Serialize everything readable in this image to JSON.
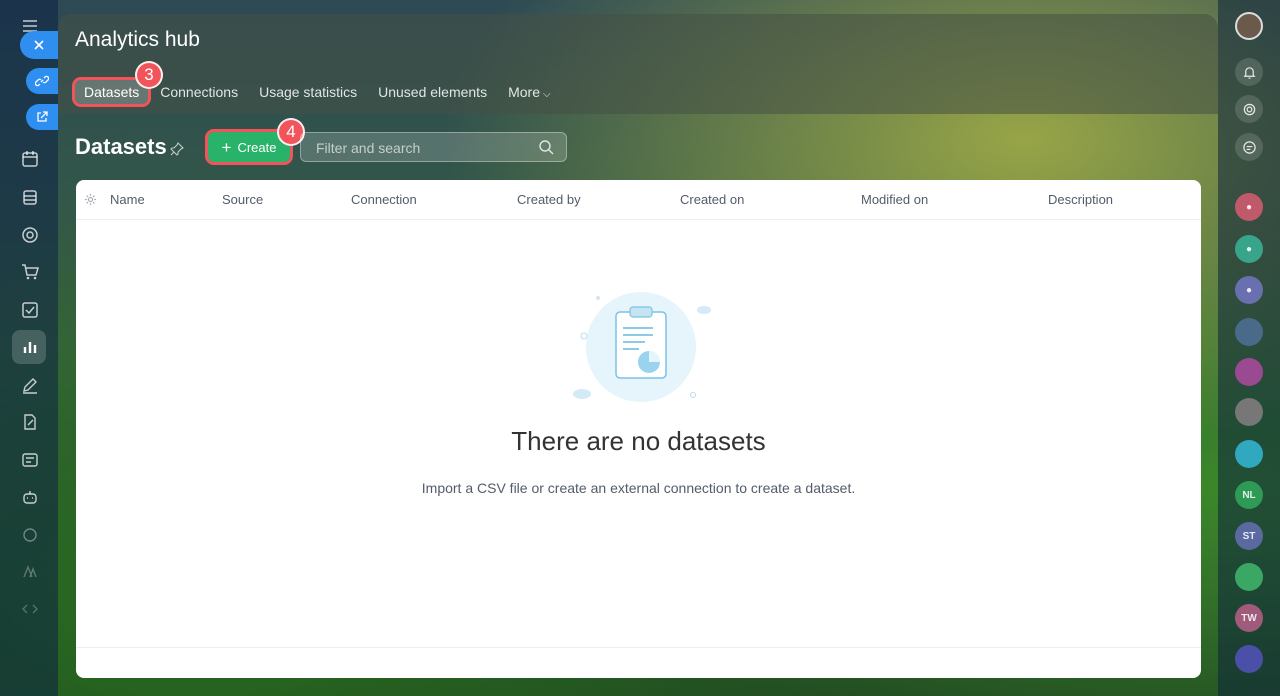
{
  "app": {
    "title": "Analytics hub"
  },
  "tabs": [
    {
      "label": "Datasets"
    },
    {
      "label": "Connections"
    },
    {
      "label": "Usage statistics"
    },
    {
      "label": "Unused elements"
    },
    {
      "label": "More"
    }
  ],
  "badges": {
    "step_tabs": "3",
    "step_create": "4"
  },
  "page": {
    "title": "Datasets"
  },
  "toolbar": {
    "create_label": "Create",
    "search_placeholder": "Filter and search"
  },
  "table": {
    "columns": [
      "Name",
      "Source",
      "Connection",
      "Created by",
      "Created on",
      "Modified on",
      "Description"
    ]
  },
  "empty_state": {
    "title": "There are no datasets",
    "description": "Import a CSV file or create an external connection to create a dataset."
  },
  "right_rail": {
    "initials": [
      "NL",
      "ST",
      "TW"
    ]
  },
  "colors": {
    "accent": "#29b36a",
    "highlight": "#f2545b",
    "rail_blue": "#2f8ff0"
  },
  "icons": [
    "menu-icon",
    "close-icon",
    "link-icon",
    "external-link-icon",
    "calendar-icon",
    "database-icon",
    "target-icon",
    "cart-icon",
    "checkbox-icon",
    "chart-icon",
    "pen-icon",
    "edit-doc-icon",
    "card-icon",
    "robot-icon",
    "settings-icon",
    "gear-icon",
    "pin-icon",
    "search-icon",
    "bell-icon",
    "chat-icon"
  ]
}
